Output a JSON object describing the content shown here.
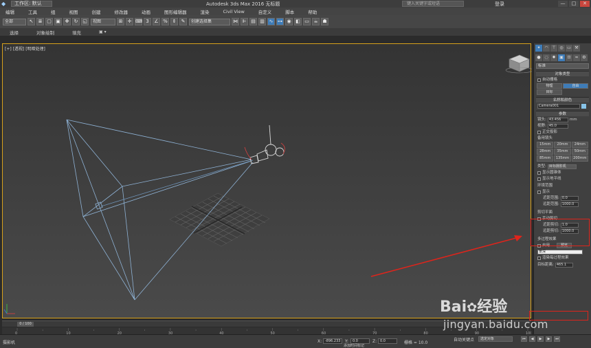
{
  "titlebar": {
    "workspace": "工作区: 默认",
    "title": "Autodesk 3ds Max 2016     无标题",
    "search_placeholder": "键入关键字或短语",
    "login": "登录",
    "win_min": "—",
    "win_max": "□",
    "win_close": "✕"
  },
  "menu": [
    "编辑",
    "工具",
    "组",
    "视图",
    "创建",
    "修改器",
    "动画",
    "图形编辑器",
    "渲染",
    "Civil View",
    "自定义",
    "脚本",
    "帮助"
  ],
  "toolbar": {
    "selection_filter": "全部",
    "ref_coord": "视图",
    "named_selection": "创建选择集"
  },
  "ribbon_tabs": [
    "选择",
    "对象绘制",
    "填充"
  ],
  "viewport": {
    "label": "[+] [透视] [明暗处理]"
  },
  "command_panel": {
    "category": "标准",
    "object_type_title": "对象类型",
    "auto_grid": "自动栅格",
    "btn_physical": "物理",
    "btn_target": "目标",
    "btn_free": "自由",
    "name_color_title": "名称和颜色",
    "camera_name": "Camera001",
    "params_title": "参数",
    "lens_label": "镜头:",
    "lens_value": "43.456",
    "lens_unit": "mm",
    "fov_label": "视野:",
    "fov_value": "45.0",
    "ortho": "正交投影",
    "stock_lens_title": "备用镜头",
    "stock_lens": [
      "15mm",
      "20mm",
      "24mm",
      "28mm",
      "35mm",
      "50mm",
      "85mm",
      "135mm",
      "200mm"
    ],
    "type_label": "类型:",
    "type_value": "目标摄影机",
    "show_cone": "显示圆锥体",
    "show_horizon": "显示地平线",
    "env_range_title": "环境范围",
    "env_show": "显示",
    "near_range_label": "近距范围:",
    "near_range_value": "0.0",
    "far_range_label": "远距范围:",
    "far_range_value": "1000.0",
    "clip_title": "剪切平面",
    "manual_clip": "手动剪切",
    "near_clip_label": "近距剪切:",
    "near_clip_value": "1.0",
    "far_clip_label": "远距剪切:",
    "far_clip_value": "1000.0",
    "multipass_title": "多过程效果",
    "multipass_enable": "启用",
    "preview": "预览",
    "multipass_type": "景深",
    "render_per_pass": "渲染每过程效果",
    "target_dist_label": "目标距离:",
    "target_dist_value": "465.1"
  },
  "timeline": {
    "thumb": "0 / 100",
    "ticks": [
      "0",
      "10",
      "20",
      "30",
      "40",
      "50",
      "60",
      "70",
      "80",
      "90",
      "100"
    ]
  },
  "status": {
    "left": "摄影机",
    "x_label": "X:",
    "x_value": "-896.233",
    "y_label": "Y:",
    "y_value": "0.0",
    "z_label": "Z:",
    "z_value": "0.0",
    "grid": "栅格 = 10.0",
    "auto_key": "自动关键点",
    "set_key_dd": "选定对象",
    "add_time_tag": "添加时间标记"
  },
  "watermark": {
    "brand": "Bai",
    "brand2": "经验",
    "url": "jingyan.baidu.com"
  },
  "colors": {
    "viewport_border": "#d9a21b",
    "camera_wire": "#8fb3d6",
    "annotation_red": "#e0241b",
    "active_blue": "#3e7cb8"
  }
}
